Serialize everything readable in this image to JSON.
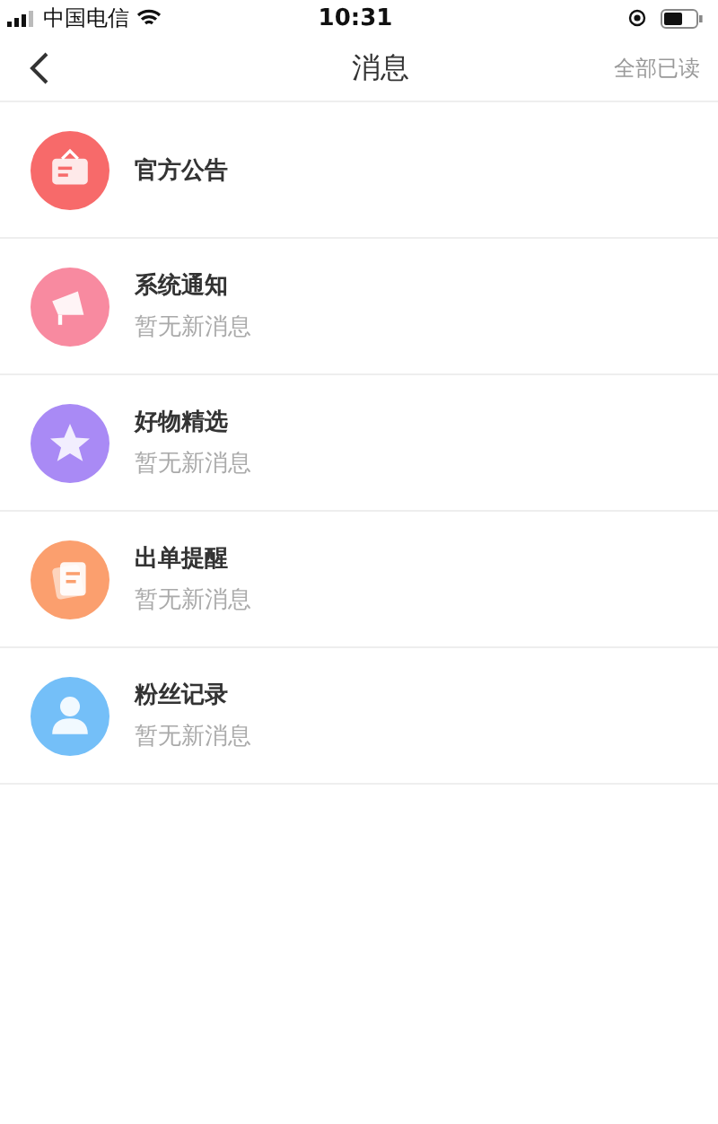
{
  "status_bar": {
    "carrier": "中国电信",
    "time": "10:31"
  },
  "nav": {
    "title": "消息",
    "action": "全部已读"
  },
  "items": [
    {
      "kind": "notice",
      "color": "#f76a6a",
      "title": "官方公告"
    },
    {
      "kind": "megaphone",
      "color": "#f88aa0",
      "title": "系统通知",
      "subtitle": "暂无新消息"
    },
    {
      "kind": "star",
      "color": "#a98af5",
      "title": "好物精选",
      "subtitle": "暂无新消息"
    },
    {
      "kind": "order",
      "color": "#fb9f6e",
      "title": "出单提醒",
      "subtitle": "暂无新消息"
    },
    {
      "kind": "fan",
      "color": "#74bff8",
      "title": "粉丝记录",
      "subtitle": "暂无新消息"
    }
  ]
}
